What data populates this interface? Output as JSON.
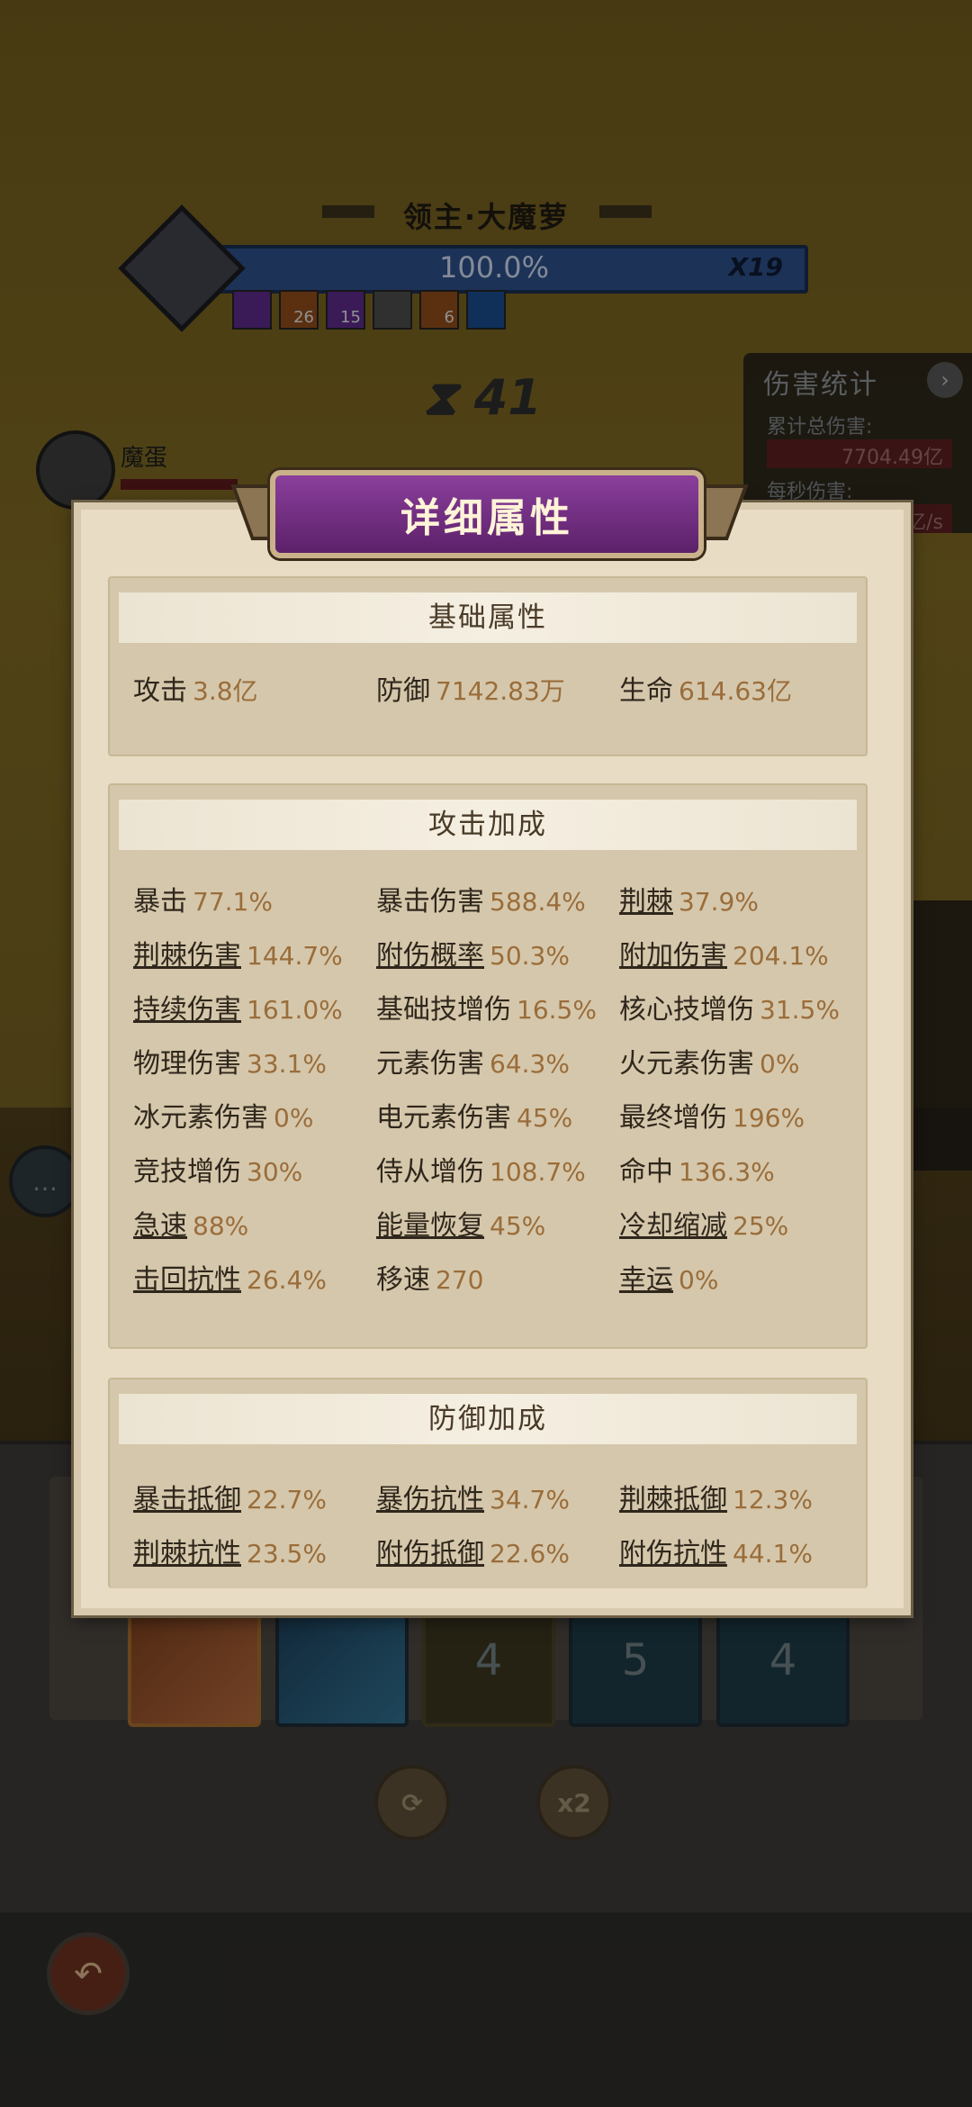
{
  "boss": {
    "name": "领主·大魔萝",
    "hp_text": "100.0%",
    "hp_fraction": 1.0,
    "multiplier": "X19",
    "buffs": [
      {
        "icon": "purple-claw-icon",
        "count": "",
        "color": "#5a2a86"
      },
      {
        "icon": "fire-claw-icon",
        "count": "26",
        "color": "#8a4a1a"
      },
      {
        "icon": "purple-scratch-icon",
        "count": "15",
        "color": "#5a2a86"
      },
      {
        "icon": "dagger-icon",
        "count": "",
        "color": "#4b4b4b"
      },
      {
        "icon": "lightning-icon",
        "count": "6",
        "color": "#8a4a1a"
      },
      {
        "icon": "snowflake-icon",
        "count": "",
        "color": "#1a4a8a"
      }
    ]
  },
  "timer": {
    "value": "41"
  },
  "damage_stats": {
    "title": "伤害统计",
    "total_label": "累计总伤害:",
    "total_value": "7704.49亿",
    "per_second_label": "每秒伤害:",
    "per_second_value": "亿/s"
  },
  "player": {
    "name": "魔蛋"
  },
  "skills": [
    {
      "count": ""
    },
    {
      "count": ""
    },
    {
      "count": "4"
    },
    {
      "count": "5"
    },
    {
      "count": "4"
    }
  ],
  "controls": {
    "refresh_icon": "refresh-icon",
    "speed_label": "x2"
  },
  "modal": {
    "title": "详细属性",
    "basic": {
      "header": "基础属性",
      "stats": [
        {
          "label": "攻击",
          "value": "3.8亿",
          "underline": false
        },
        {
          "label": "防御",
          "value": "7142.83万",
          "underline": false
        },
        {
          "label": "生命",
          "value": "614.63亿",
          "underline": false
        }
      ]
    },
    "attack": {
      "header": "攻击加成",
      "stats": [
        {
          "label": "暴击",
          "value": "77.1%",
          "underline": false
        },
        {
          "label": "暴击伤害",
          "value": "588.4%",
          "underline": false
        },
        {
          "label": "荆棘",
          "value": "37.9%",
          "underline": true
        },
        {
          "label": "荆棘伤害",
          "value": "144.7%",
          "underline": true
        },
        {
          "label": "附伤概率",
          "value": "50.3%",
          "underline": true
        },
        {
          "label": "附加伤害",
          "value": "204.1%",
          "underline": true
        },
        {
          "label": "持续伤害",
          "value": "161.0%",
          "underline": true
        },
        {
          "label": "基础技增伤",
          "value": "16.5%",
          "underline": false
        },
        {
          "label": "核心技增伤",
          "value": "31.5%",
          "underline": false
        },
        {
          "label": "物理伤害",
          "value": "33.1%",
          "underline": false
        },
        {
          "label": "元素伤害",
          "value": "64.3%",
          "underline": false
        },
        {
          "label": "火元素伤害",
          "value": "0%",
          "underline": false
        },
        {
          "label": "冰元素伤害",
          "value": "0%",
          "underline": false
        },
        {
          "label": "电元素伤害",
          "value": "45%",
          "underline": false
        },
        {
          "label": "最终增伤",
          "value": "196%",
          "underline": false
        },
        {
          "label": "竞技增伤",
          "value": "30%",
          "underline": false
        },
        {
          "label": "侍从增伤",
          "value": "108.7%",
          "underline": false
        },
        {
          "label": "命中",
          "value": "136.3%",
          "underline": false
        },
        {
          "label": "急速",
          "value": "88%",
          "underline": true
        },
        {
          "label": "能量恢复",
          "value": "45%",
          "underline": true
        },
        {
          "label": "冷却缩减",
          "value": "25%",
          "underline": true
        },
        {
          "label": "击回抗性",
          "value": "26.4%",
          "underline": true
        },
        {
          "label": "移速",
          "value": "270",
          "underline": false
        },
        {
          "label": "幸运",
          "value": "0%",
          "underline": true
        }
      ]
    },
    "defense": {
      "header": "防御加成",
      "stats": [
        {
          "label": "暴击抵御",
          "value": "22.7%",
          "underline": true
        },
        {
          "label": "暴伤抗性",
          "value": "34.7%",
          "underline": true
        },
        {
          "label": "荆棘抵御",
          "value": "12.3%",
          "underline": true
        },
        {
          "label": "荆棘抗性",
          "value": "23.5%",
          "underline": true
        },
        {
          "label": "附伤抵御",
          "value": "22.6%",
          "underline": true
        },
        {
          "label": "附伤抗性",
          "value": "44.1%",
          "underline": true
        }
      ]
    }
  }
}
